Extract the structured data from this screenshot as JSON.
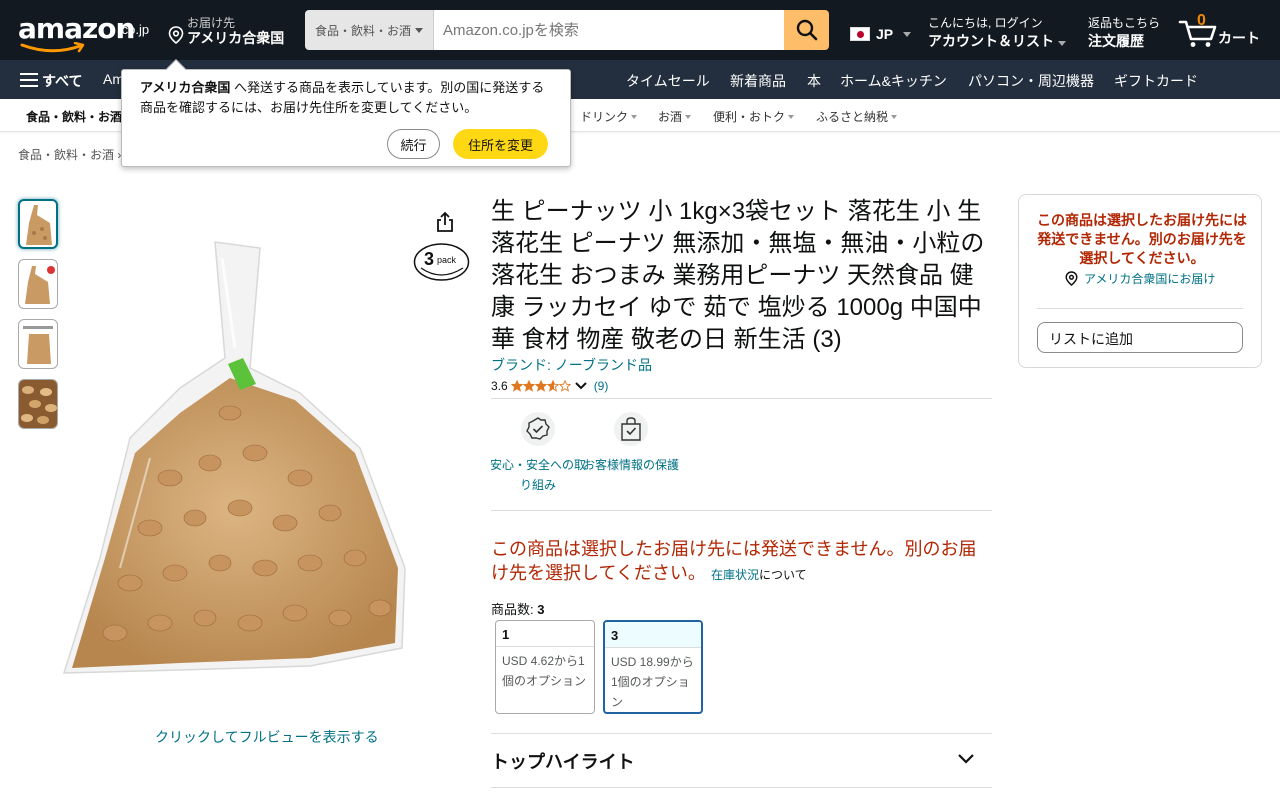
{
  "header": {
    "logo": "amazon",
    "logo_suffix": ".co.jp",
    "deliver_line1": "お届け先",
    "deliver_line2": "アメリカ合衆国",
    "search_category": "食品・飲料・お酒",
    "search_placeholder": "Amazon.co.jpを検索",
    "search_value": "",
    "language": "JP",
    "account_line1": "こんにちは, ログイン",
    "account_line2": "アカウント＆リスト",
    "orders_line1": "返品もこちら",
    "orders_line2": "注文履歴",
    "cart_count": "0",
    "cart_label": "カート"
  },
  "nav": {
    "all": "すべて",
    "items": [
      "Amazon Basics",
      "タイムセール",
      "新着商品",
      "本",
      "ホーム&キッチン",
      "パソコン・周辺機器",
      "ギフトカード"
    ]
  },
  "subnav": {
    "title": "食品・飲料・お酒",
    "items": [
      "ドリンク",
      "お酒",
      "便利・おトク",
      "ふるさと納税"
    ]
  },
  "breadcrumb": "食品・飲料・お酒",
  "popover": {
    "bold_country": "アメリカ合衆国",
    "message": " へ発送する商品を表示しています。別の国に発送する商品を確認するには、お届け先住所を変更してください。",
    "continue_label": "続行",
    "change_label": "住所を変更"
  },
  "product": {
    "title": "生 ピーナッツ 小 1kg×3袋セット 落花生 小 生落花生 ピーナツ 無添加・無塩・無油・小粒の落花生 おつまみ 業務用ピーナツ 天然食品 健康 ラッカセイ ゆで 茹で 塩炒る 1000g 中国中華 食材 物産 敬老の日 新生活 (3)",
    "brand": "ブランド: ノーブランド品",
    "rating": "3.6",
    "rating_stars": 3.6,
    "review_count": "(9)",
    "pack_badge_number": "3",
    "pack_badge_text": "pack",
    "fullview_link": "クリックしてフルビューを表示する"
  },
  "badges": [
    {
      "icon": "shield-check-icon",
      "label": "安心・安全への取り組み"
    },
    {
      "icon": "secure-bag-icon",
      "label": "お客様情報の保護"
    }
  ],
  "availability": {
    "message": "この商品は選択したお届け先には発送できません。別のお届け先を選択してください。",
    "stock_link": "在庫状況",
    "stock_suffix": "について"
  },
  "quantity": {
    "label": "商品数: ",
    "selected": "3",
    "options": [
      {
        "title": "1",
        "desc": "USD 4.62から1個のオプション"
      },
      {
        "title": "3",
        "desc": "USD 18.99から1個のオプション"
      }
    ]
  },
  "highlights_title": "トップハイライト",
  "buybox": {
    "unavailable": "この商品は選択したお届け先には発送できません。別のお届け先を選択してください。",
    "deliver_to": "アメリカ合衆国にお届け",
    "add_to_list": "リストに追加"
  },
  "colors": {
    "header_bg": "#131921",
    "nav_bg": "#232f3e",
    "link": "#007185",
    "error": "#b12704",
    "yellow_button": "#ffd814",
    "search_button": "#febd69",
    "star": "#de7921"
  }
}
